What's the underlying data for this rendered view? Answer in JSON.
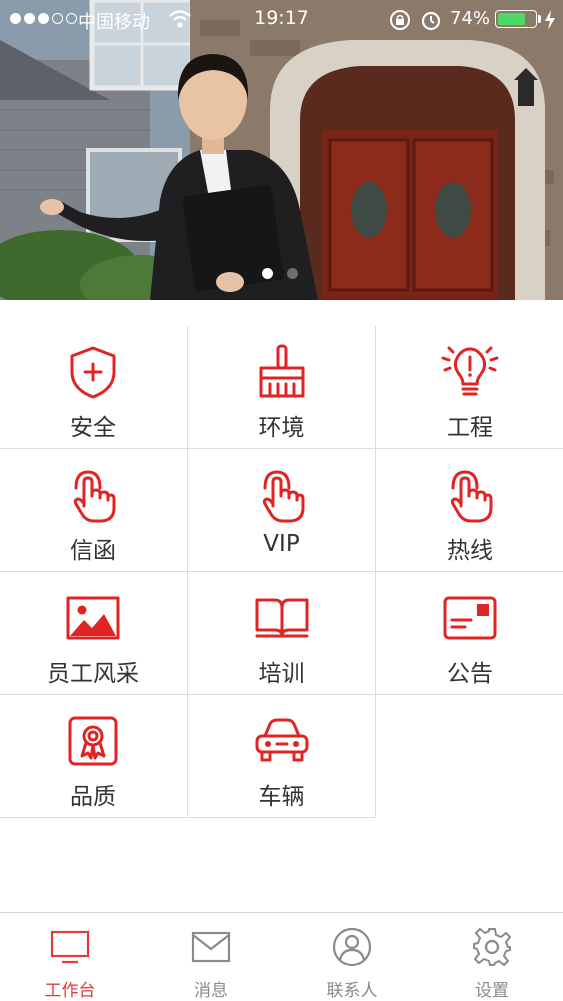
{
  "status_bar": {
    "carrier": "中国移动",
    "time": "19:17",
    "battery_percent": "74%",
    "battery_level": 0.74,
    "signal_bars_filled": 3,
    "signal_bars_total": 5
  },
  "banner": {
    "pages_total": 2,
    "active_page": 1
  },
  "theme": {
    "accent": "#e02424",
    "grid_line": "#dcdcdc",
    "tab_inactive": "#8a8a8a",
    "tab_active": "#e23b3b"
  },
  "menu": {
    "items": [
      {
        "label": "安全",
        "icon": "shield-plus-icon"
      },
      {
        "label": "环境",
        "icon": "broom-icon"
      },
      {
        "label": "工程",
        "icon": "lightbulb-alert-icon"
      },
      {
        "label": "信函",
        "icon": "hand-pointer-icon"
      },
      {
        "label": "VIP",
        "icon": "hand-pointer-icon"
      },
      {
        "label": "热线",
        "icon": "hand-pointer-icon"
      },
      {
        "label": "员工风采",
        "icon": "picture-icon"
      },
      {
        "label": "培训",
        "icon": "open-book-icon"
      },
      {
        "label": "公告",
        "icon": "postcard-icon"
      },
      {
        "label": "品质",
        "icon": "award-badge-icon"
      },
      {
        "label": "车辆",
        "icon": "car-icon"
      }
    ]
  },
  "tab_bar": {
    "tabs": [
      {
        "label": "工作台",
        "icon": "monitor-icon",
        "active": true
      },
      {
        "label": "消息",
        "icon": "envelope-icon",
        "active": false
      },
      {
        "label": "联系人",
        "icon": "person-icon",
        "active": false
      },
      {
        "label": "设置",
        "icon": "gear-icon",
        "active": false
      }
    ]
  }
}
